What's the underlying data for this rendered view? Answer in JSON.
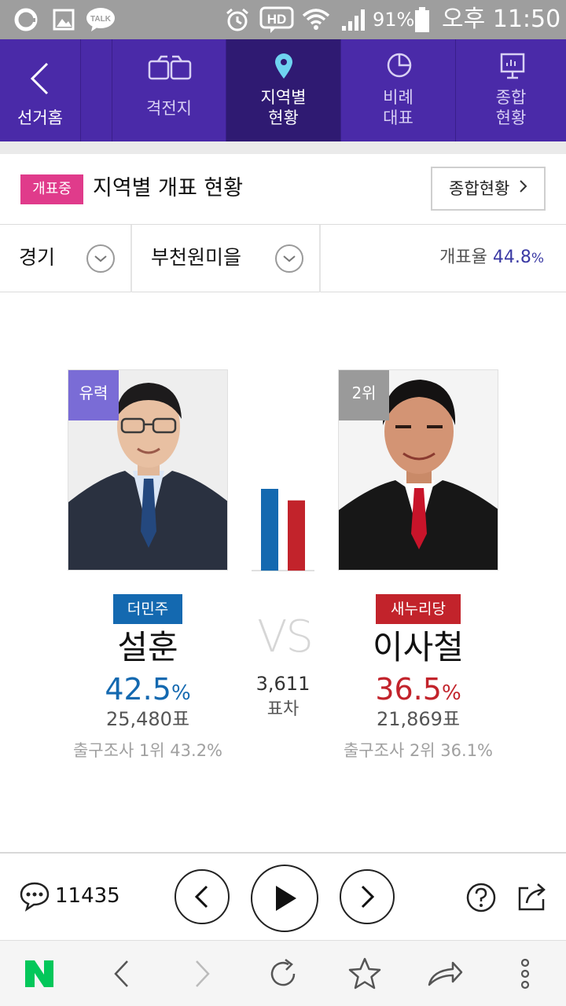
{
  "status_bar": {
    "battery": "91%",
    "time": "오후 11:50",
    "icons": [
      "o-logo-icon",
      "gallery-icon",
      "kakaotalk-icon",
      "alarm-icon",
      "hd-voice-icon",
      "wifi-icon",
      "signal-icon",
      "battery-icon"
    ],
    "talk_label": "TALK",
    "hd_label": "HD"
  },
  "nav": {
    "back_label": "선거홈",
    "tabs": [
      {
        "label_line1": "격전지",
        "label_line2": "",
        "icon": "battleground-icon"
      },
      {
        "label_line1": "지역별",
        "label_line2": "현황",
        "icon": "location-pin-icon",
        "active": true
      },
      {
        "label_line1": "비례",
        "label_line2": "대표",
        "icon": "pie-chart-icon"
      },
      {
        "label_line1": "종합",
        "label_line2": "현황",
        "icon": "monitor-icon"
      }
    ]
  },
  "header": {
    "badge": "개표중",
    "title": "지역별 개표 현황",
    "summary_button": "종합현황"
  },
  "filters": {
    "region": "경기",
    "district": "부천원미을",
    "rate_label": "개표율",
    "rate_value": "44.8",
    "rate_unit": "%"
  },
  "candidates": [
    {
      "status": "유력",
      "party": "더민주",
      "name": "설훈",
      "pct": "42.5",
      "pct_unit": "%",
      "votes": "25,480표",
      "exit_poll": "출구조사 1위 43.2%",
      "color": "#1469b0"
    },
    {
      "status": "2위",
      "party": "새누리당",
      "name": "이사철",
      "pct": "36.5",
      "pct_unit": "%",
      "votes": "21,869표",
      "exit_poll": "출구조사 2위 36.1%",
      "color": "#c2232b"
    }
  ],
  "comparison": {
    "vs": "VS",
    "margin_value": "3,611",
    "margin_label": "표차",
    "bar_values": [
      42.5,
      36.5
    ]
  },
  "bottom_bar": {
    "comment_count": "11435",
    "icons": [
      "comment-icon",
      "prev-icon",
      "play-icon",
      "next-icon",
      "help-icon",
      "share-icon"
    ]
  },
  "browser_bar": {
    "icons": [
      "naver-n-icon",
      "back-arrow-icon",
      "forward-arrow-icon",
      "refresh-icon",
      "star-icon",
      "send-icon",
      "more-icon"
    ]
  },
  "colors": {
    "nav_bg": "#4a2aa8",
    "nav_active": "#2f1a72",
    "badge_pink": "#e03b8b",
    "dem_blue": "#1469b0",
    "sae_red": "#c2232b",
    "status_purple": "#7a6cd6",
    "status_gray": "#9a9a9a",
    "naver_green": "#03c75a"
  }
}
